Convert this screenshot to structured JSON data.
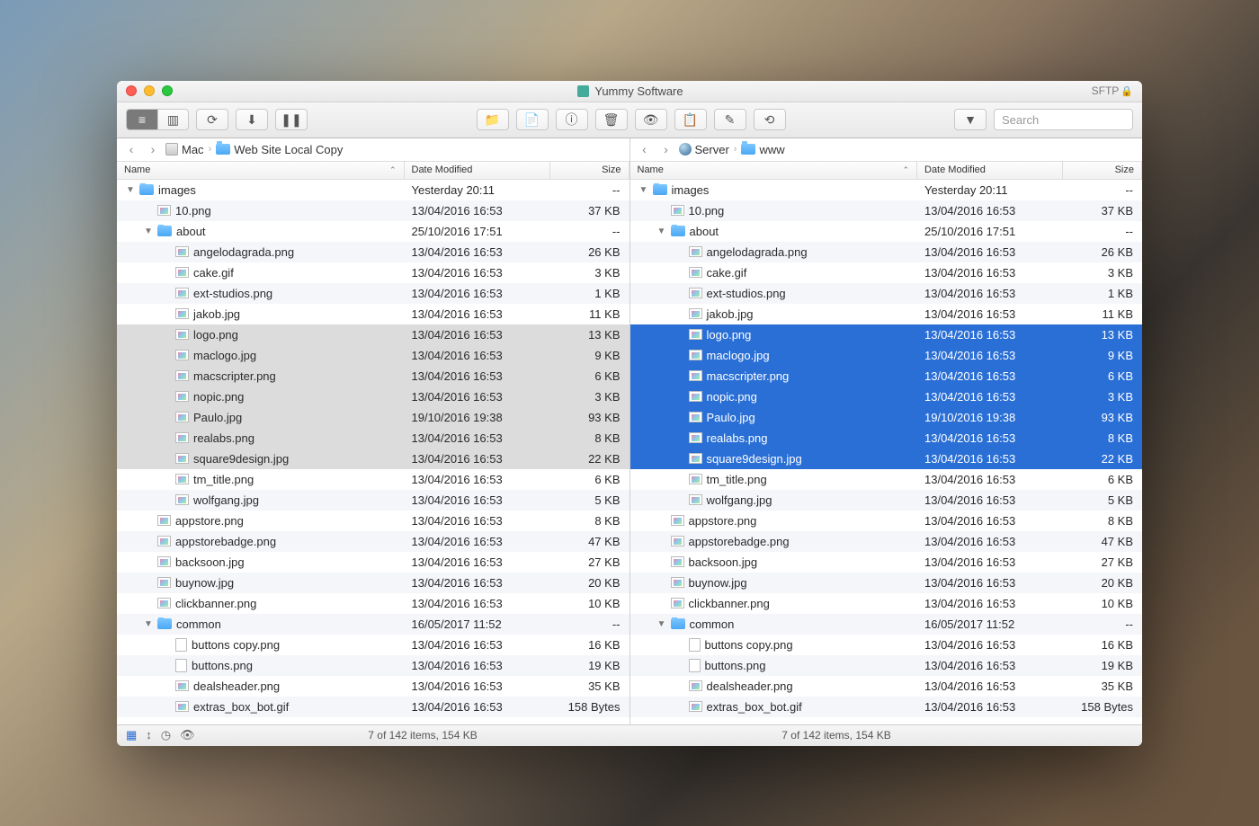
{
  "window": {
    "title": "Yummy Software",
    "protocol": "SFTP"
  },
  "toolbar": {
    "search_placeholder": "Search"
  },
  "left": {
    "nav": {
      "root": "Mac",
      "folder": "Web Site Local Copy"
    },
    "columns": {
      "name": "Name",
      "date": "Date Modified",
      "size": "Size"
    },
    "status": "7 of 142 items, 154 KB"
  },
  "right": {
    "nav": {
      "root": "Server",
      "folder": "www"
    },
    "columns": {
      "name": "Name",
      "date": "Date Modified",
      "size": "Size"
    },
    "status": "7 of 142 items, 154 KB"
  },
  "rows": [
    {
      "depth": 0,
      "type": "folder",
      "expanded": true,
      "name": "images",
      "date": "Yesterday 20:11",
      "size": "--"
    },
    {
      "depth": 1,
      "type": "image",
      "name": "10.png",
      "date": "13/04/2016 16:53",
      "size": "37 KB"
    },
    {
      "depth": 1,
      "type": "folder",
      "expanded": true,
      "name": "about",
      "date": "25/10/2016 17:51",
      "size": "--"
    },
    {
      "depth": 2,
      "type": "image",
      "name": "angelodagrada.png",
      "date": "13/04/2016 16:53",
      "size": "26 KB"
    },
    {
      "depth": 2,
      "type": "image",
      "name": "cake.gif",
      "date": "13/04/2016 16:53",
      "size": "3 KB"
    },
    {
      "depth": 2,
      "type": "image",
      "name": "ext-studios.png",
      "date": "13/04/2016 16:53",
      "size": "1 KB"
    },
    {
      "depth": 2,
      "type": "image",
      "name": "jakob.jpg",
      "date": "13/04/2016 16:53",
      "size": "11 KB"
    },
    {
      "depth": 2,
      "type": "image",
      "name": "logo.png",
      "date": "13/04/2016 16:53",
      "size": "13 KB",
      "sel": true
    },
    {
      "depth": 2,
      "type": "image",
      "name": "maclogo.jpg",
      "date": "13/04/2016 16:53",
      "size": "9 KB",
      "sel": true
    },
    {
      "depth": 2,
      "type": "image",
      "name": "macscripter.png",
      "date": "13/04/2016 16:53",
      "size": "6 KB",
      "sel": true
    },
    {
      "depth": 2,
      "type": "image",
      "name": "nopic.png",
      "date": "13/04/2016 16:53",
      "size": "3 KB",
      "sel": true
    },
    {
      "depth": 2,
      "type": "image",
      "name": "Paulo.jpg",
      "date": "19/10/2016 19:38",
      "size": "93 KB",
      "sel": true
    },
    {
      "depth": 2,
      "type": "image",
      "name": "realabs.png",
      "date": "13/04/2016 16:53",
      "size": "8 KB",
      "sel": true
    },
    {
      "depth": 2,
      "type": "image",
      "name": "square9design.jpg",
      "date": "13/04/2016 16:53",
      "size": "22 KB",
      "sel": true
    },
    {
      "depth": 2,
      "type": "image",
      "name": "tm_title.png",
      "date": "13/04/2016 16:53",
      "size": "6 KB"
    },
    {
      "depth": 2,
      "type": "image",
      "name": "wolfgang.jpg",
      "date": "13/04/2016 16:53",
      "size": "5 KB"
    },
    {
      "depth": 1,
      "type": "image",
      "name": "appstore.png",
      "date": "13/04/2016 16:53",
      "size": "8 KB"
    },
    {
      "depth": 1,
      "type": "image",
      "name": "appstorebadge.png",
      "date": "13/04/2016 16:53",
      "size": "47 KB"
    },
    {
      "depth": 1,
      "type": "image",
      "name": "backsoon.jpg",
      "date": "13/04/2016 16:53",
      "size": "27 KB"
    },
    {
      "depth": 1,
      "type": "image",
      "name": "buynow.jpg",
      "date": "13/04/2016 16:53",
      "size": "20 KB"
    },
    {
      "depth": 1,
      "type": "image",
      "name": "clickbanner.png",
      "date": "13/04/2016 16:53",
      "size": "10 KB"
    },
    {
      "depth": 1,
      "type": "folder",
      "expanded": true,
      "name": "common",
      "date": "16/05/2017 11:52",
      "size": "--"
    },
    {
      "depth": 2,
      "type": "file",
      "name": "buttons copy.png",
      "date": "13/04/2016 16:53",
      "size": "16 KB"
    },
    {
      "depth": 2,
      "type": "file",
      "name": "buttons.png",
      "date": "13/04/2016 16:53",
      "size": "19 KB"
    },
    {
      "depth": 2,
      "type": "image",
      "name": "dealsheader.png",
      "date": "13/04/2016 16:53",
      "size": "35 KB"
    },
    {
      "depth": 2,
      "type": "image",
      "name": "extras_box_bot.gif",
      "date": "13/04/2016 16:53",
      "size": "158 Bytes"
    }
  ]
}
